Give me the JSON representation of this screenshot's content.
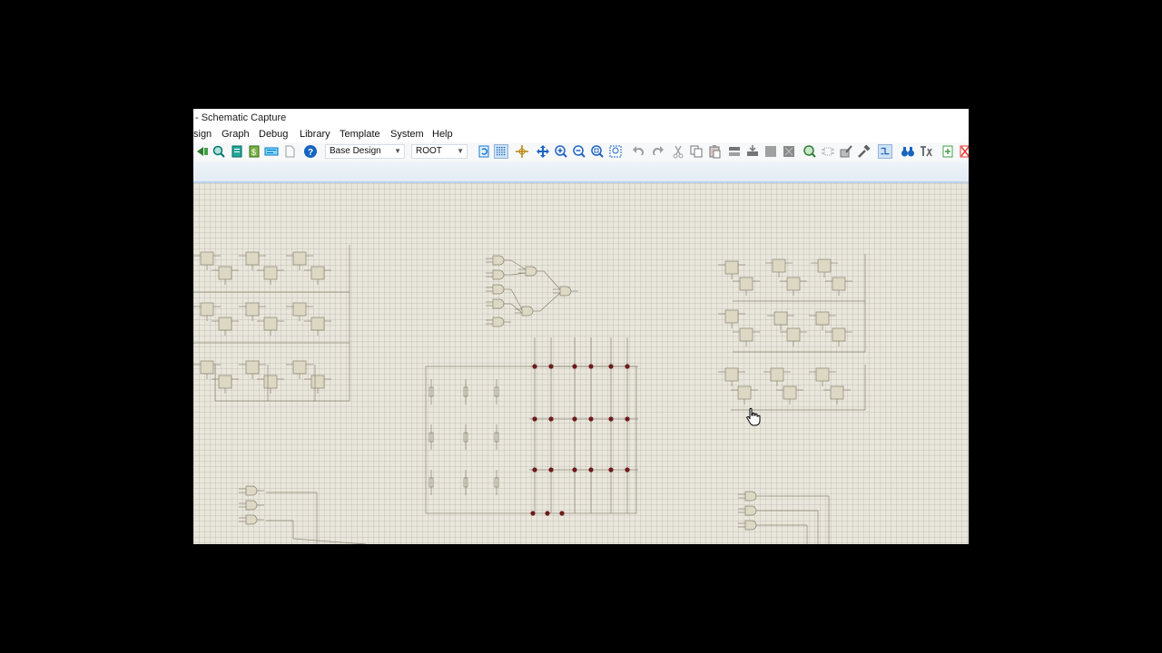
{
  "window": {
    "title": "- Schematic Capture"
  },
  "menu": {
    "items": [
      "sign",
      "Graph",
      "Debug",
      "Library",
      "Template",
      "System",
      "Help"
    ]
  },
  "toolbar": {
    "design_select": "Base Design",
    "sheet_select": "ROOT",
    "icons": [
      "previous-icon",
      "find-icon",
      "bill-of-materials-icon",
      "cost-icon",
      "ide-icon",
      "document-icon",
      "help-icon",
      "refresh-icon",
      "grid-icon",
      "origin-icon",
      "pan-icon",
      "zoom-in-icon",
      "zoom-out-icon",
      "zoom-all-icon",
      "zoom-area-icon",
      "undo-icon",
      "redo-icon",
      "cut-icon",
      "copy-icon",
      "paste-icon",
      "block-copy-icon",
      "block-move-icon",
      "block-rotate-icon",
      "block-delete-icon",
      "pick-parts-icon",
      "make-device-icon",
      "package-tool-icon",
      "decompose-icon",
      "wire-autorouter-icon",
      "search-tag-icon",
      "property-assignment-icon",
      "new-sheet-icon",
      "remove-sheet-icon"
    ]
  },
  "cursor": {
    "type": "hand-pointer-icon"
  }
}
